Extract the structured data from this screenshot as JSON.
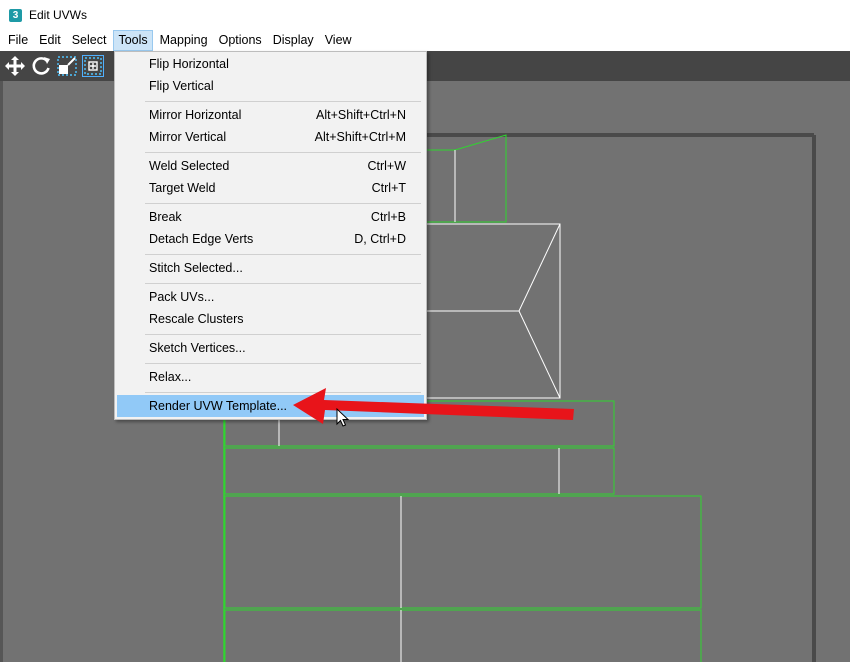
{
  "window": {
    "title": "Edit UVWs",
    "app_icon_text": "3"
  },
  "menubar": {
    "items": [
      {
        "label": "File"
      },
      {
        "label": "Edit"
      },
      {
        "label": "Select"
      },
      {
        "label": "Tools"
      },
      {
        "label": "Mapping"
      },
      {
        "label": "Options"
      },
      {
        "label": "Display"
      },
      {
        "label": "View"
      }
    ]
  },
  "toolbar": {
    "icons": [
      "move-icon",
      "rotate-icon",
      "scale-icon",
      "freeform-icon"
    ]
  },
  "tools_menu": {
    "items": [
      {
        "label": "Flip Horizontal",
        "shortcut": ""
      },
      {
        "label": "Flip Vertical",
        "shortcut": ""
      },
      {
        "label": "Mirror Horizontal",
        "shortcut": "Alt+Shift+Ctrl+N"
      },
      {
        "label": "Mirror Vertical",
        "shortcut": "Alt+Shift+Ctrl+M"
      },
      {
        "label": "Weld Selected",
        "shortcut": "Ctrl+W"
      },
      {
        "label": "Target Weld",
        "shortcut": "Ctrl+T"
      },
      {
        "label": "Break",
        "shortcut": "Ctrl+B"
      },
      {
        "label": "Detach Edge Verts",
        "shortcut": "D, Ctrl+D"
      },
      {
        "label": "Stitch Selected...",
        "shortcut": ""
      },
      {
        "label": "Pack UVs...",
        "shortcut": ""
      },
      {
        "label": "Rescale Clusters",
        "shortcut": ""
      },
      {
        "label": "Sketch Vertices...",
        "shortcut": ""
      },
      {
        "label": "Relax...",
        "shortcut": ""
      },
      {
        "label": "Render UVW Template...",
        "shortcut": ""
      }
    ],
    "highlighted": "Render UVW Template..."
  },
  "colors": {
    "uv_edge": "#2fd62f",
    "uv_inner": "#ffffff",
    "annotation_arrow": "#e8141a",
    "highlight": "#91c9f7"
  }
}
